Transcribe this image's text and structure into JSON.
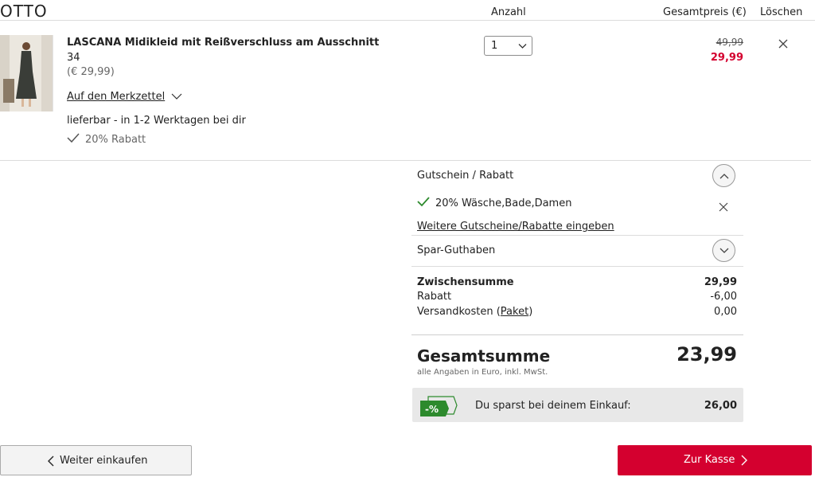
{
  "header": {
    "logo": "OTTO",
    "col_quantity": "Anzahl",
    "col_total": "Gesamtpreis (€)",
    "col_delete": "Löschen"
  },
  "item": {
    "title": "LASCANA Midikleid mit Reißverschluss am Ausschnitt",
    "size": "34",
    "unit_price": "(€ 29,99)",
    "wishlist_link": "Auf den Merkzettel",
    "availability": "lieferbar - in 1-2 Werktagen bei dir",
    "discount_note": "20% Rabatt",
    "quantity": "1",
    "price_old": "49,99",
    "price_new": "29,99"
  },
  "voucher": {
    "label": "Gutschein / Rabatt",
    "applied": "20% Wäsche,Bade,Damen",
    "more_link": "Weitere Gutscheine/Rabatte eingeben"
  },
  "savings_credit": {
    "label": "Spar-Guthaben"
  },
  "summary": {
    "subtotal_label": "Zwischensumme",
    "subtotal_value": "29,99",
    "discount_label": "Rabatt",
    "discount_value": "-6,00",
    "shipping_label": "Versandkosten (",
    "shipping_link": "Paket",
    "shipping_close": ")",
    "shipping_value": "0,00",
    "total_label": "Gesamtsumme",
    "total_value": "23,99",
    "total_note": "alle Angaben in Euro, inkl. MwSt."
  },
  "savings": {
    "badge": "-%",
    "text": "Du sparst bei deinem Einkauf:",
    "value": "26,00"
  },
  "actions": {
    "continue_label": "Weiter einkaufen",
    "checkout_label": "Zur Kasse"
  },
  "colors": {
    "accent_red": "#d4002f",
    "badge_green": "#2d8a2d"
  }
}
